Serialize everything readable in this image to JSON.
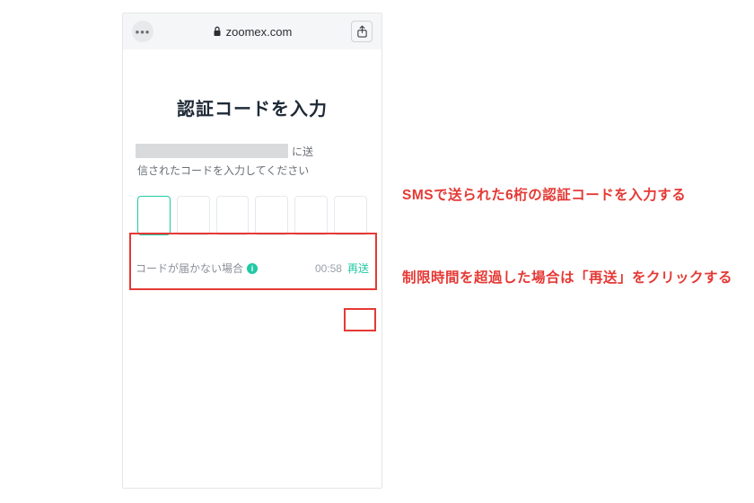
{
  "browser": {
    "domain": "zoomex.com"
  },
  "page": {
    "title": "認証コードを入力",
    "instruction_tail": "に送",
    "instruction_line2": "信されたコードを入力してください",
    "resend_label": "コードが届かない場合",
    "timer": "00:58",
    "resend_link": "再送",
    "info_glyph": "i"
  },
  "annotations": {
    "note1": "SMSで送られた6桁の認証コードを入力する",
    "note2": "制限時間を超過した場合は「再送」をクリックする"
  }
}
